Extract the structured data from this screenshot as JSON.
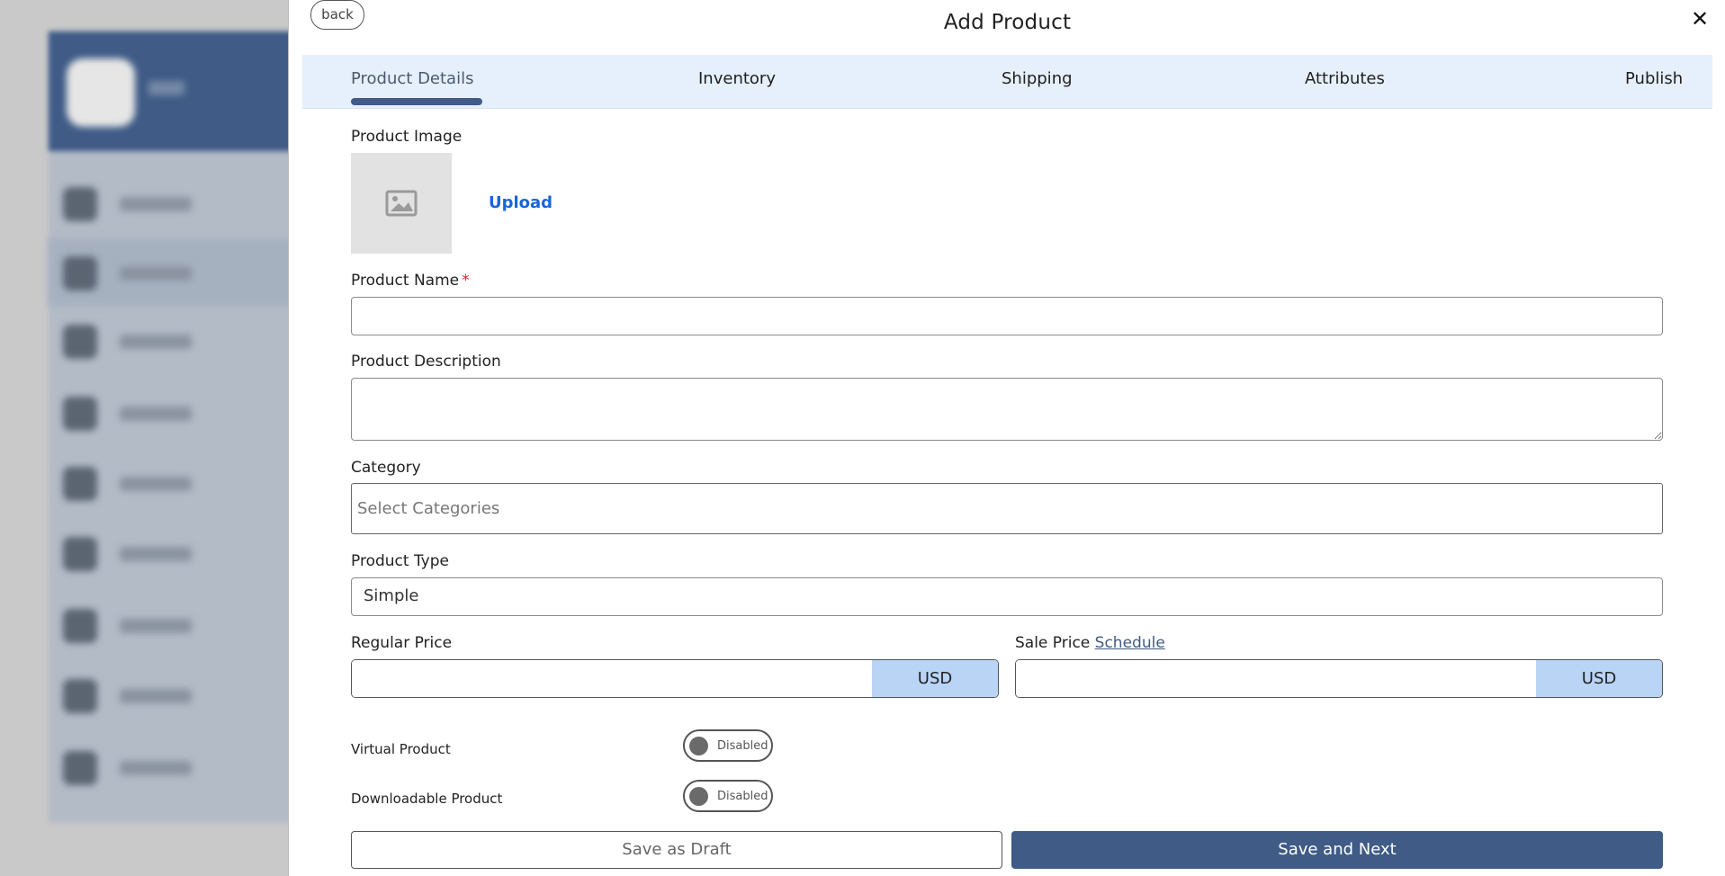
{
  "modal": {
    "title": "Add Product",
    "back_label": "back",
    "close_symbol": "✕"
  },
  "tabs": [
    {
      "label": "Product Details",
      "active": true
    },
    {
      "label": "Inventory",
      "active": false
    },
    {
      "label": "Shipping",
      "active": false
    },
    {
      "label": "Attributes",
      "active": false
    },
    {
      "label": "Publish",
      "active": false
    }
  ],
  "form": {
    "product_image_label": "Product Image",
    "upload_label": "Upload",
    "product_name_label": "Product Name",
    "required_mark": "*",
    "product_name_value": "",
    "product_description_label": "Product Description",
    "category_label": "Category",
    "category_placeholder": "Select Categories",
    "product_type_label": "Product Type",
    "product_type_value": "Simple",
    "regular_price_label": "Regular Price",
    "regular_price_value": "",
    "regular_price_currency": "USD",
    "sale_price_label": "Sale Price",
    "schedule_label": "Schedule",
    "sale_price_value": "",
    "sale_price_currency": "USD",
    "virtual_product_label": "Virtual Product",
    "virtual_product_state": "Disabled",
    "downloadable_product_label": "Downloadable Product",
    "downloadable_product_state": "Disabled"
  },
  "actions": {
    "save_draft_label": "Save as Draft",
    "save_next_label": "Save and Next"
  },
  "colors": {
    "primary": "#3f5b86",
    "tab_bar": "#e6effc",
    "currency_bg": "#b9d4f5",
    "link": "#1766d6"
  },
  "icons": {
    "image_placeholder": "image-icon",
    "close": "close-icon"
  }
}
